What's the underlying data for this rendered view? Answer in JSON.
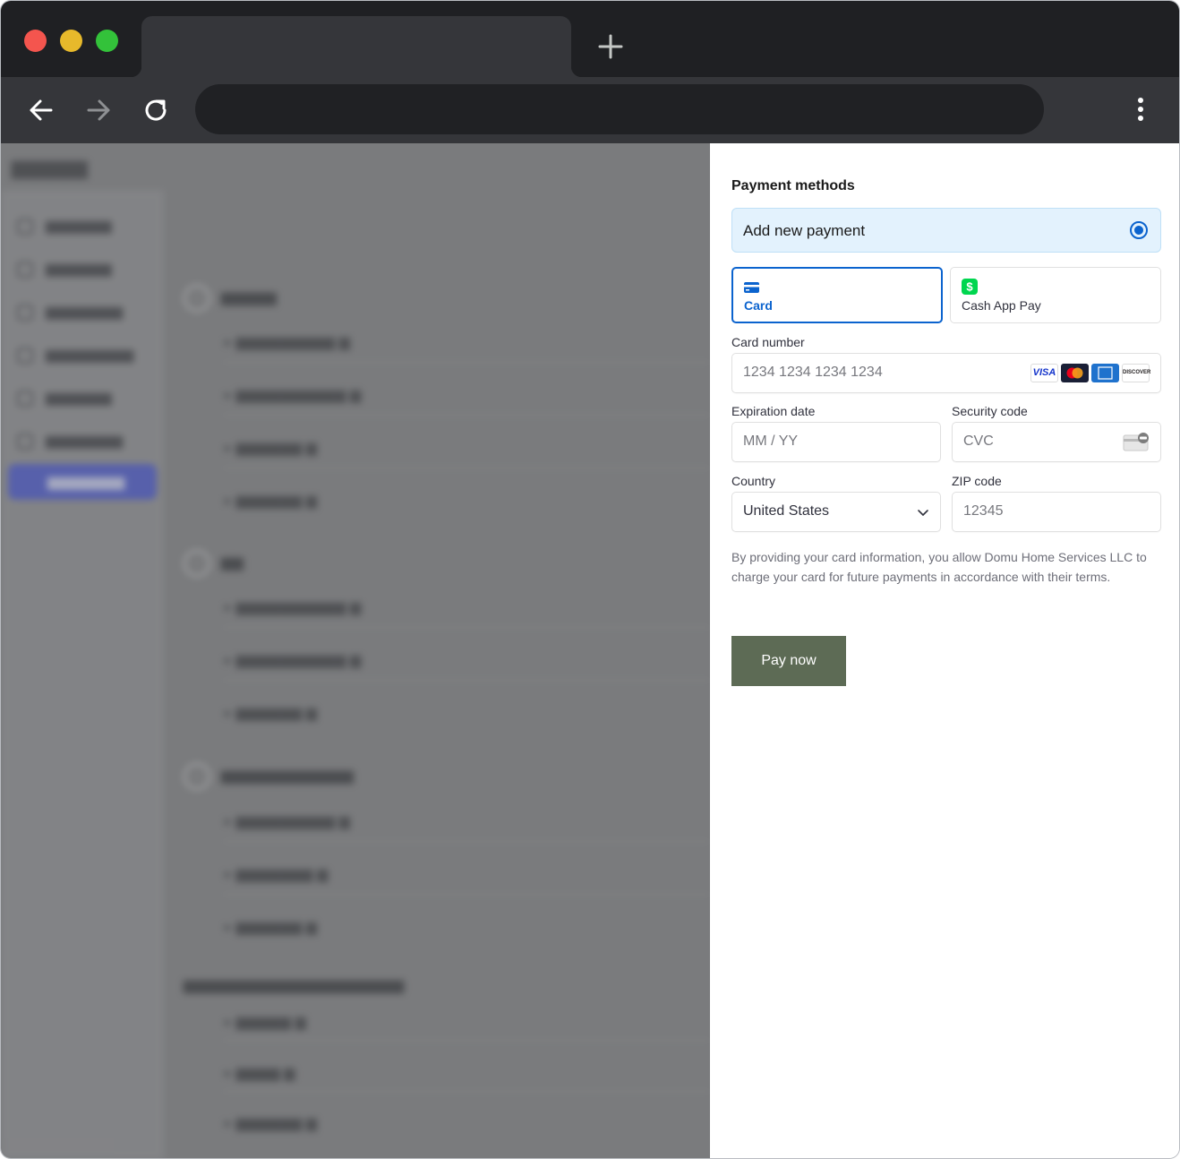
{
  "panel": {
    "section_title": "Payment methods",
    "add_new_label": "Add new payment",
    "methods": [
      {
        "label": "Card"
      },
      {
        "label": "Cash App Pay"
      }
    ],
    "card_number": {
      "label": "Card number",
      "placeholder": "1234 1234 1234 1234"
    },
    "brands": [
      "VISA",
      "DISCOVER"
    ],
    "expiration": {
      "label": "Expiration date",
      "placeholder": "MM / YY"
    },
    "security": {
      "label": "Security code",
      "placeholder": "CVC"
    },
    "country": {
      "label": "Country",
      "value": "United States"
    },
    "zip": {
      "label": "ZIP code",
      "placeholder": "12345"
    },
    "legal_text": "By providing your card information, you allow Domu Home Services LLC to charge your card for future payments in accordance with their terms.",
    "pay_button": "Pay now"
  },
  "colors": {
    "accent": "#0b63ce",
    "pay_button": "#5d6b55",
    "selected_bg": "#e3f2fd",
    "cash_app_green": "#00d64f"
  }
}
